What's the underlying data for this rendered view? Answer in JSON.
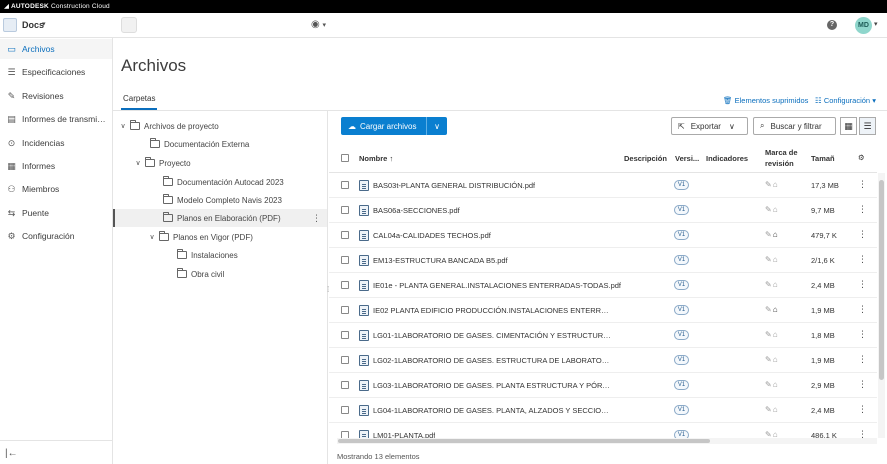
{
  "brand": {
    "name": "AUTODESK",
    "product": "Construction Cloud"
  },
  "appbar": {
    "app_name": "Docs",
    "globe_icon": "globe-icon",
    "help": "?",
    "avatar_initials": "MD"
  },
  "sidebar": {
    "items": [
      {
        "label": "Archivos",
        "icon": "folder-icon",
        "active": true
      },
      {
        "label": "Especificaciones",
        "icon": "spec-icon"
      },
      {
        "label": "Revisiones",
        "icon": "review-icon"
      },
      {
        "label": "Informes de transmisi...",
        "icon": "transmittal-icon"
      },
      {
        "label": "Incidencias",
        "icon": "issue-icon"
      },
      {
        "label": "Informes",
        "icon": "reports-icon"
      },
      {
        "label": "Miembros",
        "icon": "members-icon"
      },
      {
        "label": "Puente",
        "icon": "bridge-icon"
      },
      {
        "label": "Configuración",
        "icon": "gear-icon"
      }
    ]
  },
  "main": {
    "title": "Archivos",
    "tab": "Carpetas",
    "deleted_link": "Elementos suprimidos",
    "settings_link": "Configuración"
  },
  "tree": [
    {
      "label": "Archivos de proyecto",
      "level": 0,
      "expanded": true,
      "has_children": true
    },
    {
      "label": "Documentación Externa",
      "level": 1,
      "has_children": false
    },
    {
      "label": "Proyecto",
      "level": 1,
      "expanded": true,
      "has_children": true
    },
    {
      "label": "Documentación Autocad 2023",
      "level": 2,
      "has_children": false
    },
    {
      "label": "Modelo Completo Navis 2023",
      "level": 2,
      "has_children": false
    },
    {
      "label": "Planos en Elaboración (PDF)",
      "level": 2,
      "has_children": false,
      "selected": true
    },
    {
      "label": "Planos en Vigor (PDF)",
      "level": 2,
      "expanded": true,
      "has_children": true
    },
    {
      "label": "Instalaciones",
      "level": 3,
      "has_children": false
    },
    {
      "label": "Obra civil",
      "level": 3,
      "has_children": false
    }
  ],
  "toolbar": {
    "upload": "Cargar archivos",
    "export": "Exportar",
    "search": "Buscar y filtrar"
  },
  "table": {
    "headers": {
      "name": "Nombre",
      "description": "Descripción",
      "version": "Versi...",
      "indicators": "Indicadores",
      "mark_line1": "Marca de",
      "mark_line2": "revisión",
      "size": "Tamañ"
    },
    "rows": [
      {
        "name": "BAS03t-PLANTA GENERAL DISTRIBUCIÓN.pdf",
        "version": "V1",
        "size": "17,3 MB"
      },
      {
        "name": "BAS06a-SECCIONES.pdf",
        "version": "V1",
        "size": "9,7 MB"
      },
      {
        "name": "CAL04a-CALIDADES TECHOS.pdf",
        "version": "V1",
        "size": "479,7 K"
      },
      {
        "name": "EM13-ESTRUCTURA BANCADA B5.pdf",
        "version": "V1",
        "size": "2/1,6 K"
      },
      {
        "name": "IE01e - PLANTA GENERAL.INSTALACIONES ENTERRADAS-TODAS.pdf",
        "version": "V1",
        "size": "2,4 MB"
      },
      {
        "name": "IE02 PLANTA EDIFICIO PRODUCCIÓN.INSTALACIONES ENTERRADA...",
        "version": "V1",
        "size": "1,9 MB"
      },
      {
        "name": "LG01-1LABORATORIO DE GASES. CIMENTACIÓN Y ESTRUCTURA. PL...",
        "version": "V1",
        "size": "1,8 MB"
      },
      {
        "name": "LG02-1LABORATORIO DE GASES. ESTRUCTURA DE LABORATORIO Y ...",
        "version": "V1",
        "size": "1,9 MB"
      },
      {
        "name": "LG03-1LABORATORIO DE GASES. PLANTA ESTRUCTURA Y PÓRTICO...",
        "version": "V1",
        "size": "2,9 MB"
      },
      {
        "name": "LG04-1LABORATORIO DE GASES. PLANTA, ALZADOS Y SECCIONES.p...",
        "version": "V1",
        "size": "2,4 MB"
      },
      {
        "name": "LM01-PLANTA.pdf",
        "version": "V1",
        "size": "486,1 K"
      }
    ]
  },
  "footer": "Mostrando 13 elementos"
}
